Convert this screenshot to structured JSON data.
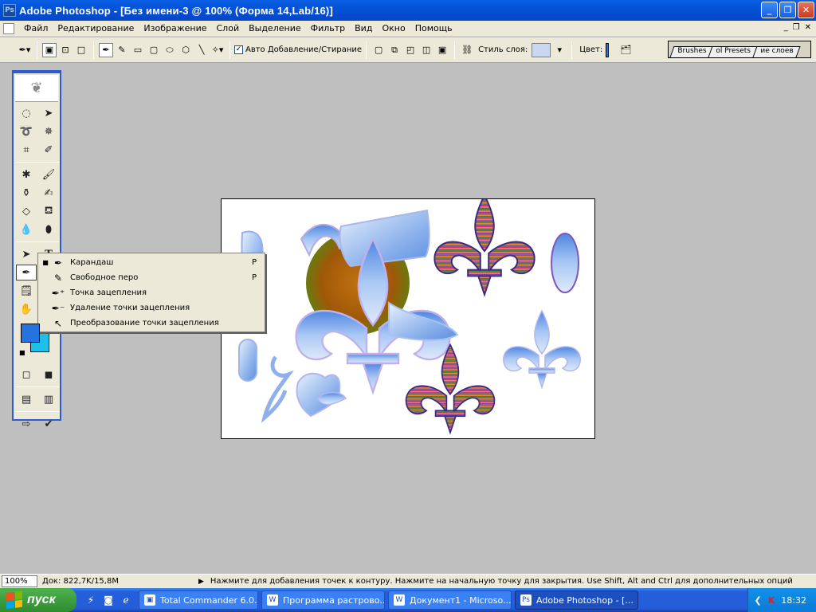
{
  "window": {
    "title": "Adobe Photoshop - [Без имени-3 @ 100% (Форма 14,Lab/16)]"
  },
  "menu": [
    "Файл",
    "Редактирование",
    "Изображение",
    "Слой",
    "Выделение",
    "Фильтр",
    "Вид",
    "Окно",
    "Помощь"
  ],
  "options": {
    "auto_add_delete": "Авто Добавление/Стирание",
    "auto_add_checked": true,
    "layer_style_label": "Стиль слоя:",
    "color_label": "Цвет:",
    "palette_tabs": [
      "Brushes",
      "ol Presets",
      "ие слоев"
    ]
  },
  "toolbox": {
    "fg_color": "#2673e0",
    "bg_color": "#1fc0e8"
  },
  "flyout": {
    "items": [
      {
        "label": "Карандаш",
        "key": "P",
        "selected": true
      },
      {
        "label": "Свободное перо",
        "key": "P",
        "selected": false
      },
      {
        "label": "Точка зацепления",
        "key": "",
        "selected": false
      },
      {
        "label": "Удаление точки зацепления",
        "key": "",
        "selected": false
      },
      {
        "label": "Преобразование точки зацепления",
        "key": "",
        "selected": false
      }
    ]
  },
  "status": {
    "zoom": "100%",
    "doc": "Док: 822,7K/15,8M",
    "hint": "Нажмите для добавления точек к контуру.  Нажмите на начальную точку для закрытия.  Use Shift, Alt and Ctrl для дополнительных опций"
  },
  "taskbar": {
    "start": "пуск",
    "tasks": [
      {
        "label": "Total Commander 6.0...",
        "active": false
      },
      {
        "label": "Программа растрово...",
        "active": false
      },
      {
        "label": "Документ1 - Microso...",
        "active": false
      },
      {
        "label": "Adobe Photoshop - [...",
        "active": true
      }
    ],
    "clock": "18:32"
  }
}
